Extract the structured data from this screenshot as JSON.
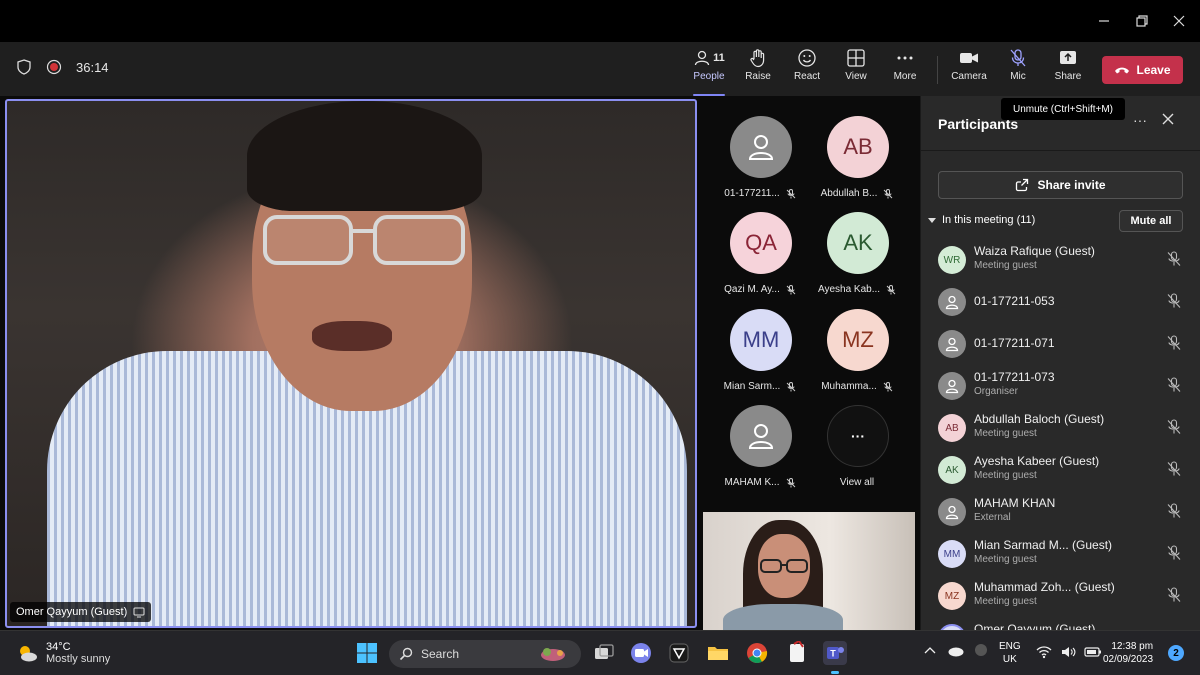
{
  "window": {
    "minimize_label": "–",
    "maximize_label": "❐",
    "close_label": "✕"
  },
  "toolbar": {
    "timer": "36:14",
    "people_count": "11",
    "people_label": "People",
    "raise_label": "Raise",
    "react_label": "React",
    "view_label": "View",
    "more_label": "More",
    "camera_label": "Camera",
    "mic_label": "Mic",
    "share_label": "Share",
    "leave_label": "Leave",
    "mic_tooltip": "Unmute (Ctrl+Shift+M)"
  },
  "stage": {
    "main_speaker": "Omer Qayyum (Guest)",
    "tiles": [
      {
        "initials": "",
        "name": "01-177211...",
        "bg": "#8a8a8a",
        "fg": "#ffffff",
        "icon": "person-icon"
      },
      {
        "initials": "AB",
        "name": "Abdullah B...",
        "bg": "#f3d2d6",
        "fg": "#7a2b35"
      },
      {
        "initials": "QA",
        "name": "Qazi M. Ay...",
        "bg": "#f6d3da",
        "fg": "#8a2436"
      },
      {
        "initials": "AK",
        "name": "Ayesha Kab...",
        "bg": "#d2ead5",
        "fg": "#2b5a31"
      },
      {
        "initials": "MM",
        "name": "Mian Sarm...",
        "bg": "#d9dcf6",
        "fg": "#3b3f8a"
      },
      {
        "initials": "MZ",
        "name": "Muhamma...",
        "bg": "#f7d8cf",
        "fg": "#8a3420"
      },
      {
        "initials": "",
        "name": "MAHAM K...",
        "bg": "#8a8a8a",
        "fg": "#ffffff",
        "icon": "person-icon"
      },
      {
        "initials": "···",
        "name": "View all",
        "bg": "#111111",
        "fg": "#ffffff"
      }
    ]
  },
  "panel": {
    "title": "Participants",
    "more": "···",
    "share_invite": "Share invite",
    "section_label": "In this meeting (11)",
    "mute_all": "Mute all",
    "participants": [
      {
        "initials": "WR",
        "name": "Waiza Rafique (Guest)",
        "role": "Meeting guest",
        "bg": "#d4ecd6",
        "fg": "#2f6b35"
      },
      {
        "initials": "",
        "name": "01-177211-053",
        "role": "",
        "bg": "#8a8a8a",
        "fg": "#ffffff"
      },
      {
        "initials": "",
        "name": "01-177211-071",
        "role": "",
        "bg": "#8a8a8a",
        "fg": "#ffffff"
      },
      {
        "initials": "",
        "name": "01-177211-073",
        "role": "Organiser",
        "bg": "#8a8a8a",
        "fg": "#ffffff"
      },
      {
        "initials": "AB",
        "name": "Abdullah Baloch (Guest)",
        "role": "Meeting guest",
        "bg": "#f3d2d6",
        "fg": "#7a2b35"
      },
      {
        "initials": "AK",
        "name": "Ayesha Kabeer (Guest)",
        "role": "Meeting guest",
        "bg": "#d2ead5",
        "fg": "#2b5a31"
      },
      {
        "initials": "",
        "name": "MAHAM KHAN",
        "role": "External",
        "bg": "#8a8a8a",
        "fg": "#ffffff"
      },
      {
        "initials": "MM",
        "name": "Mian Sarmad M...  (Guest)",
        "role": "Meeting guest",
        "bg": "#d9dcf6",
        "fg": "#3b3f8a"
      },
      {
        "initials": "MZ",
        "name": "Muhammad Zoh... (Guest)",
        "role": "Meeting guest",
        "bg": "#f7d8cf",
        "fg": "#8a3420"
      },
      {
        "initials": "OQ",
        "name": "Omer Qayyum (Guest)",
        "role": "",
        "bg": "#d9dcf6",
        "fg": "#3b3f8a"
      }
    ]
  },
  "taskbar": {
    "temperature": "34°C",
    "weather": "Mostly sunny",
    "search_label": "Search",
    "lang_1": "ENG",
    "lang_2": "UK",
    "time": "12:38 pm",
    "date": "02/09/2023",
    "notification_count": "2"
  }
}
